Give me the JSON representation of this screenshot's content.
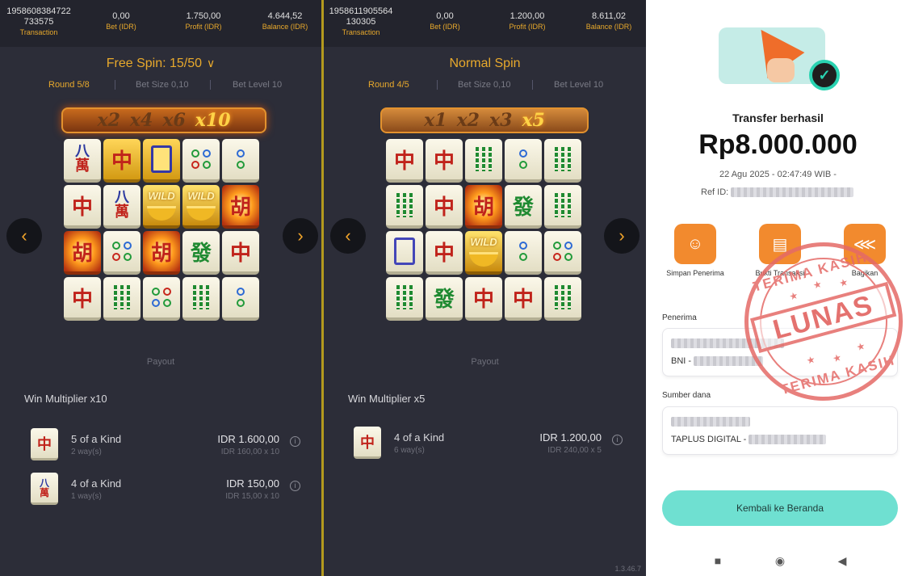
{
  "panel1": {
    "transaction_id_1": "1958608384722",
    "transaction_id_2": "733575",
    "transaction_label": "Transaction",
    "bet_value": "0,00",
    "bet_label": "Bet (IDR)",
    "profit_value": "1.750,00",
    "profit_label": "Profit (IDR)",
    "balance_value": "4.644,52",
    "balance_label": "Balance (IDR)",
    "spin_title": "Free Spin: 15/50",
    "round": "Round 5/8",
    "bet_size": "Bet Size 0,10",
    "bet_level": "Bet Level 10",
    "multipliers": [
      "x2",
      "x4",
      "x6",
      "x10"
    ],
    "payout_label": "Payout",
    "win_multiplier": "Win Multiplier x10",
    "payouts": [
      {
        "kind": "5 of a Kind",
        "ways": "2 way(s)",
        "amount": "IDR 1.600,00",
        "calc": "IDR 160,00 x 10",
        "symbol": "中"
      },
      {
        "kind": "4 of a Kind",
        "ways": "1 way(s)",
        "amount": "IDR 150,00",
        "calc": "IDR 15,00 x 10",
        "symbol": "八萬"
      }
    ]
  },
  "panel2": {
    "transaction_id_1": "1958611905564",
    "transaction_id_2": "130305",
    "transaction_label": "Transaction",
    "bet_value": "0,00",
    "bet_label": "Bet (IDR)",
    "profit_value": "1.200,00",
    "profit_label": "Profit (IDR)",
    "balance_value": "8.611,02",
    "balance_label": "Balance (IDR)",
    "spin_title": "Normal Spin",
    "round": "Round 4/5",
    "bet_size": "Bet Size 0,10",
    "bet_level": "Bet Level 10",
    "multipliers": [
      "x1",
      "x2",
      "x3",
      "x5"
    ],
    "payout_label": "Payout",
    "win_multiplier": "Win Multiplier x5",
    "payouts": [
      {
        "kind": "4 of a Kind",
        "ways": "6 way(s)",
        "amount": "IDR 1.200,00",
        "calc": "IDR 240,00 x 5",
        "symbol": "中"
      }
    ],
    "version": "1.3.46.7"
  },
  "receipt": {
    "title": "Transfer berhasil",
    "amount": "Rp8.000.000",
    "date": "22 Agu 2025 - 02:47:49 WIB -",
    "ref_label": "Ref ID:",
    "actions": [
      {
        "label": "Simpan Penerima",
        "icon": "add-user-icon"
      },
      {
        "label": "Bukti Transaksi",
        "icon": "receipt-icon"
      },
      {
        "label": "Bagikan",
        "icon": "share-icon"
      }
    ],
    "recipient_label": "Penerima",
    "recipient_bank": "BNI -",
    "source_label": "Sumber dana",
    "source_account": "TAPLUS DIGITAL -",
    "home_button": "Kembali ke Beranda",
    "stamp_text": "LUNAS",
    "stamp_arc_top": "TERIMA KASIH",
    "stamp_arc_bottom": "TERIMA KASIH"
  },
  "colors": {
    "accent_gold": "#e8a92c",
    "game_bg": "#2c2d38",
    "receipt_orange": "#f28a2e",
    "home_button": "#6fe0d1",
    "stamp_red": "#e56a67"
  }
}
